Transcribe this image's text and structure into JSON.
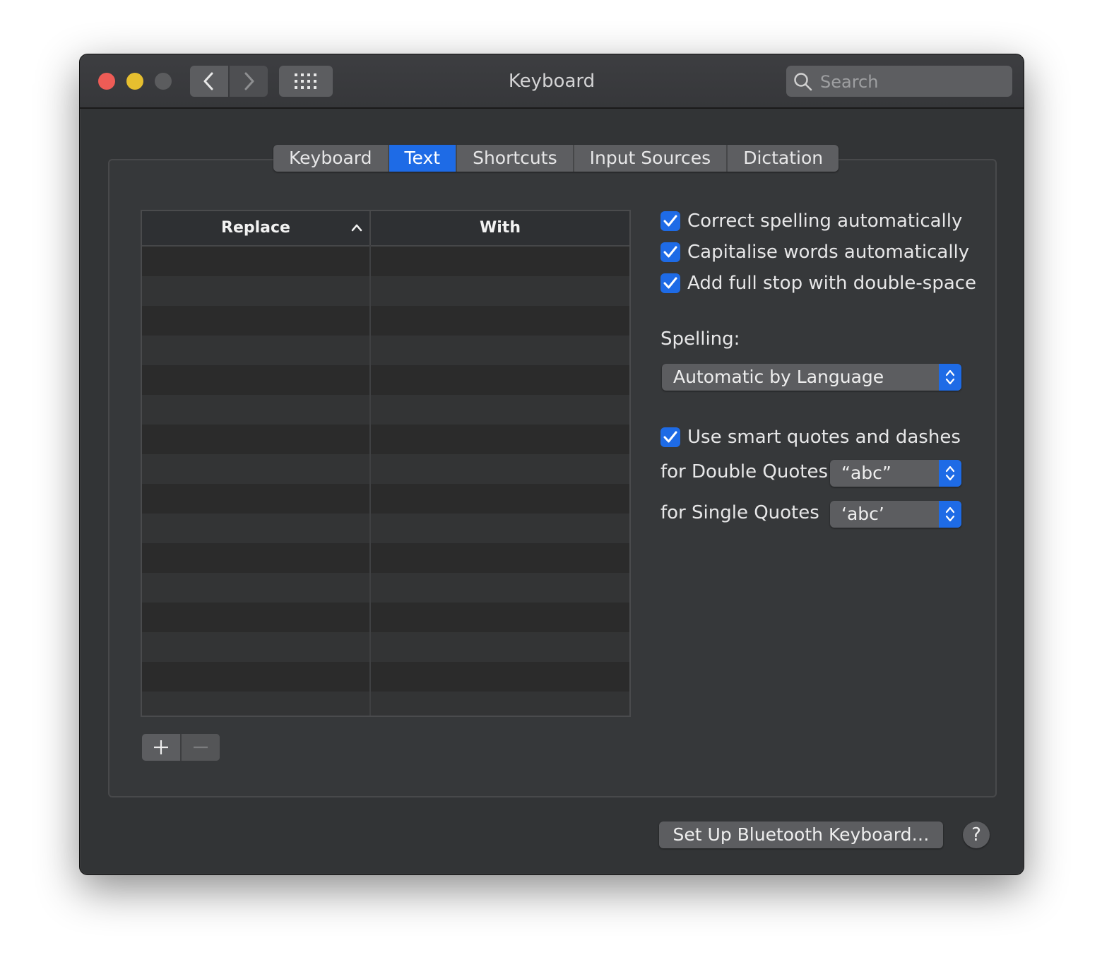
{
  "window": {
    "title": "Keyboard"
  },
  "toolbar": {
    "back_icon": "chevron-left-icon",
    "forward_icon": "chevron-right-icon",
    "grid_icon": "grid-icon"
  },
  "search": {
    "placeholder": "Search",
    "value": ""
  },
  "tabs": [
    {
      "label": "Keyboard",
      "active": false
    },
    {
      "label": "Text",
      "active": true
    },
    {
      "label": "Shortcuts",
      "active": false
    },
    {
      "label": "Input Sources",
      "active": false
    },
    {
      "label": "Dictation",
      "active": false
    }
  ],
  "table": {
    "columns": [
      {
        "label": "Replace",
        "sorted": "ascending"
      },
      {
        "label": "With"
      }
    ],
    "rows": []
  },
  "options": {
    "correct_spelling": {
      "label": "Correct spelling automatically",
      "checked": true
    },
    "capitalise_words": {
      "label": "Capitalise words automatically",
      "checked": true
    },
    "full_stop": {
      "label": "Add full stop with double-space",
      "checked": true
    },
    "spelling_label": "Spelling:",
    "spelling_value": "Automatic by Language",
    "smart_quotes": {
      "label": "Use smart quotes and dashes",
      "checked": true
    },
    "double_quotes_label": "for Double Quotes",
    "double_quotes_value": "“abc”",
    "single_quotes_label": "for Single Quotes",
    "single_quotes_value": "‘abc’"
  },
  "footer": {
    "bluetooth_label": "Set Up Bluetooth Keyboard…",
    "help_label": "?"
  },
  "colors": {
    "accent": "#1e6be6",
    "window_bg": "#323436",
    "close": "#ee5c56",
    "minimize": "#e6bf2f",
    "maximize": "#5b5c5e"
  }
}
